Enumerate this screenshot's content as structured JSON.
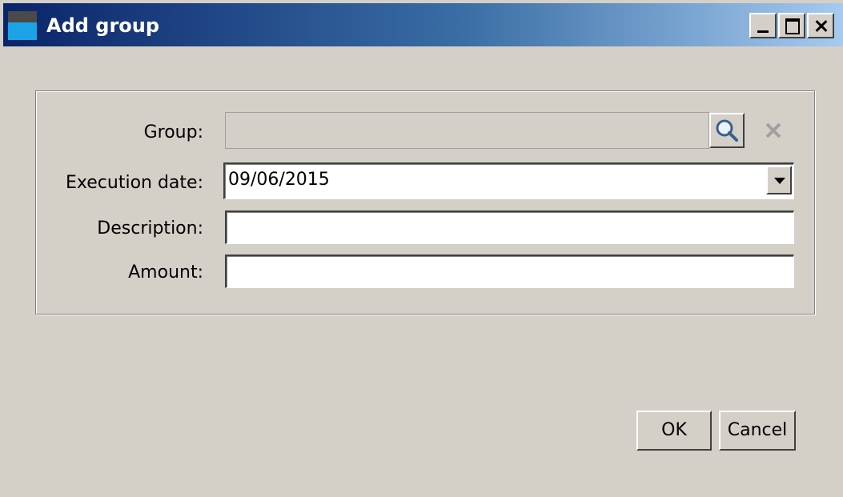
{
  "window": {
    "title": "Add group",
    "controls": {
      "minimize": "minimize",
      "maximize": "maximize",
      "close": "close"
    }
  },
  "form": {
    "group": {
      "label": "Group:",
      "value": ""
    },
    "execution_date": {
      "label": "Execution date:",
      "value": "09/06/2015"
    },
    "description": {
      "label": "Description:",
      "value": ""
    },
    "amount": {
      "label": "Amount:",
      "value": ""
    }
  },
  "buttons": {
    "ok": "OK",
    "cancel": "Cancel"
  },
  "icons": {
    "search": "search-icon",
    "clear": "clear-x-icon",
    "dropdown": "dropdown-arrow-icon"
  },
  "colors": {
    "titlebar_start": "#0a246a",
    "titlebar_end": "#a6caf0",
    "window_bg": "#d4d0c8"
  }
}
